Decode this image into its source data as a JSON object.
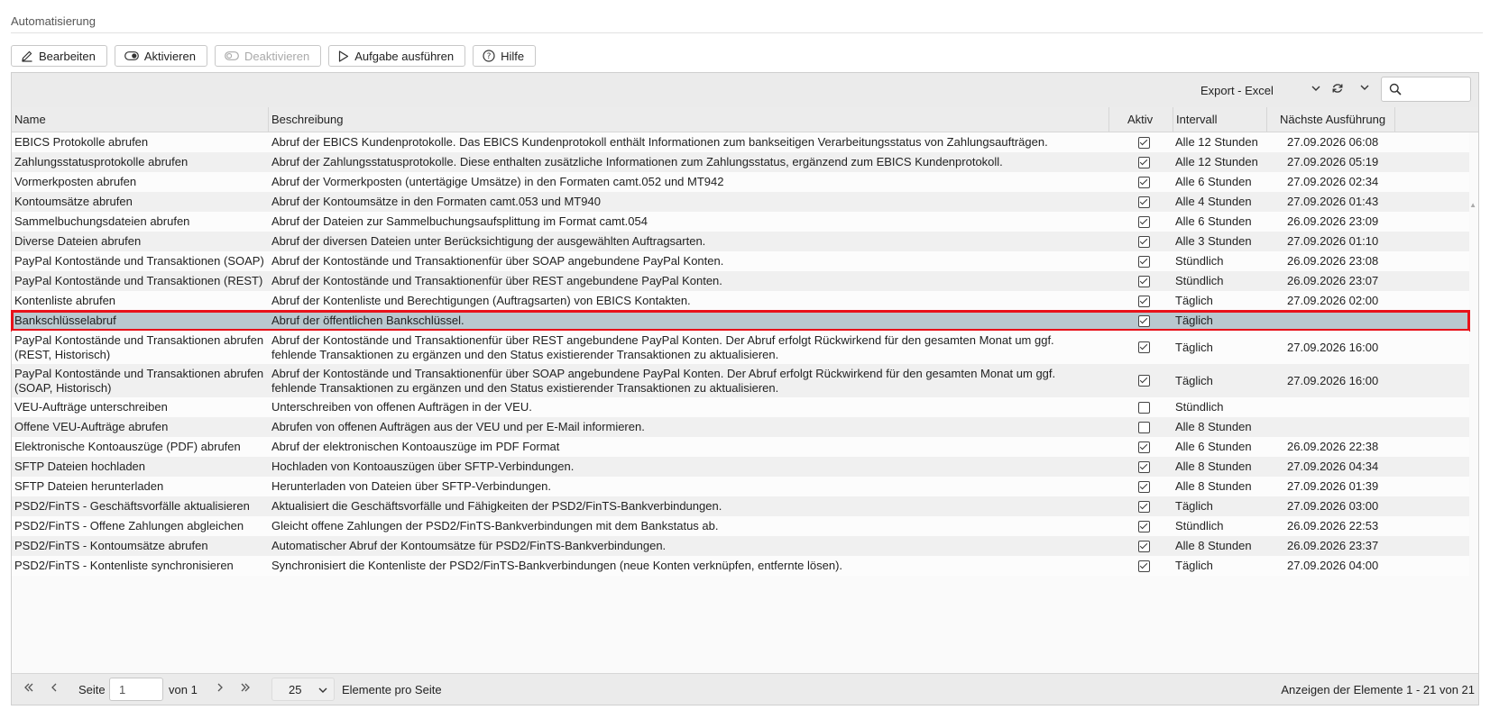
{
  "page": {
    "title": "Automatisierung"
  },
  "toolbar": {
    "edit": "Bearbeiten",
    "activate": "Aktivieren",
    "deactivate": "Deaktivieren",
    "run": "Aufgabe ausführen",
    "help": "Hilfe"
  },
  "grid_toolbar": {
    "export": "Export - Excel",
    "search_value": ""
  },
  "columns": {
    "name": "Name",
    "description": "Beschreibung",
    "active": "Aktiv",
    "interval": "Intervall",
    "next_run": "Nächste Ausführung"
  },
  "rows": [
    {
      "name": "EBICS Protokolle abrufen",
      "description": "Abruf der EBICS Kundenprotokolle. Das EBICS Kundenprotokoll enthält Informationen zum bankseitigen Verarbeitungsstatus von Zahlungsaufträgen.",
      "active": true,
      "interval": "Alle 12 Stunden",
      "next": "27.09.2026 06:08",
      "selected": false
    },
    {
      "name": "Zahlungsstatusprotokolle abrufen",
      "description": "Abruf der Zahlungsstatusprotokolle. Diese enthalten zusätzliche Informationen zum Zahlungsstatus, ergänzend zum EBICS Kundenprotokoll.",
      "active": true,
      "interval": "Alle 12 Stunden",
      "next": "27.09.2026 05:19",
      "selected": false
    },
    {
      "name": "Vormerkposten abrufen",
      "description": "Abruf der Vormerkposten (untertägige Umsätze) in den Formaten camt.052 und MT942",
      "active": true,
      "interval": "Alle 6 Stunden",
      "next": "27.09.2026 02:34",
      "selected": false
    },
    {
      "name": "Kontoumsätze abrufen",
      "description": "Abruf der Kontoumsätze in den Formaten camt.053 und MT940",
      "active": true,
      "interval": "Alle 4 Stunden",
      "next": "27.09.2026 01:43",
      "selected": false
    },
    {
      "name": "Sammelbuchungsdateien abrufen",
      "description": "Abruf der Dateien zur Sammelbuchungsaufsplittung im Format camt.054",
      "active": true,
      "interval": "Alle 6 Stunden",
      "next": "26.09.2026 23:09",
      "selected": false
    },
    {
      "name": "Diverse Dateien abrufen",
      "description": "Abruf der diversen Dateien unter Berücksichtigung der ausgewählten Auftragsarten.",
      "active": true,
      "interval": "Alle 3 Stunden",
      "next": "27.09.2026 01:10",
      "selected": false
    },
    {
      "name": "PayPal Kontostände und Transaktionen (SOAP)",
      "description": "Abruf der Kontostände und Transaktionenfür über SOAP angebundene PayPal Konten.",
      "active": true,
      "interval": "Stündlich",
      "next": "26.09.2026 23:08",
      "selected": false
    },
    {
      "name": "PayPal Kontostände und Transaktionen (REST)",
      "description": "Abruf der Kontostände und Transaktionenfür über REST angebundene PayPal Konten.",
      "active": true,
      "interval": "Stündlich",
      "next": "26.09.2026 23:07",
      "selected": false
    },
    {
      "name": "Kontenliste abrufen",
      "description": "Abruf der Kontenliste und Berechtigungen (Auftragsarten) von EBICS Kontakten.",
      "active": true,
      "interval": "Täglich",
      "next": "27.09.2026 02:00",
      "selected": false
    },
    {
      "name": "Bankschlüsselabruf",
      "description": "Abruf der öffentlichen Bankschlüssel.",
      "active": true,
      "interval": "Täglich",
      "next": "",
      "selected": true
    },
    {
      "name": "PayPal Kontostände und Transaktionen abrufen (REST, Historisch)",
      "description": "Abruf der Kontostände und Transaktionenfür über REST angebundene PayPal Konten. Der Abruf erfolgt Rückwirkend für den gesamten Monat um ggf. fehlende Transaktionen zu ergänzen und den Status existierender Transaktionen zu aktualisieren.",
      "active": true,
      "interval": "Täglich",
      "next": "27.09.2026 16:00",
      "selected": false,
      "tall": true
    },
    {
      "name": "PayPal Kontostände und Transaktionen abrufen (SOAP, Historisch)",
      "description": "Abruf der Kontostände und Transaktionenfür über SOAP angebundene PayPal Konten. Der Abruf erfolgt Rückwirkend für den gesamten Monat um ggf. fehlende Transaktionen zu ergänzen und den Status existierender Transaktionen zu aktualisieren.",
      "active": true,
      "interval": "Täglich",
      "next": "27.09.2026 16:00",
      "selected": false,
      "tall": true
    },
    {
      "name": "VEU-Aufträge unterschreiben",
      "description": "Unterschreiben von offenen Aufträgen in der VEU.",
      "active": false,
      "interval": "Stündlich",
      "next": "",
      "selected": false
    },
    {
      "name": "Offene VEU-Aufträge abrufen",
      "description": "Abrufen von offenen Aufträgen aus der VEU und per E-Mail informieren.",
      "active": false,
      "interval": "Alle 8 Stunden",
      "next": "",
      "selected": false
    },
    {
      "name": "Elektronische Kontoauszüge (PDF) abrufen",
      "description": "Abruf der elektronischen Kontoauszüge im PDF Format",
      "active": true,
      "interval": "Alle 6 Stunden",
      "next": "26.09.2026 22:38",
      "selected": false
    },
    {
      "name": "SFTP Dateien hochladen",
      "description": "Hochladen von Kontoauszügen über SFTP-Verbindungen.",
      "active": true,
      "interval": "Alle 8 Stunden",
      "next": "27.09.2026 04:34",
      "selected": false
    },
    {
      "name": "SFTP Dateien herunterladen",
      "description": "Herunterladen von Dateien über SFTP-Verbindungen.",
      "active": true,
      "interval": "Alle 8 Stunden",
      "next": "27.09.2026 01:39",
      "selected": false
    },
    {
      "name": "PSD2/FinTS - Geschäftsvorfälle aktualisieren",
      "description": "Aktualisiert die Geschäftsvorfälle und Fähigkeiten der PSD2/FinTS-Bankverbindungen.",
      "active": true,
      "interval": "Täglich",
      "next": "27.09.2026 03:00",
      "selected": false
    },
    {
      "name": "PSD2/FinTS - Offene Zahlungen abgleichen",
      "description": "Gleicht offene Zahlungen der PSD2/FinTS-Bankverbindungen mit dem Bankstatus ab.",
      "active": true,
      "interval": "Stündlich",
      "next": "26.09.2026 22:53",
      "selected": false
    },
    {
      "name": "PSD2/FinTS - Kontoumsätze abrufen",
      "description": "Automatischer Abruf der Kontoumsätze für PSD2/FinTS-Bankverbindungen.",
      "active": true,
      "interval": "Alle 8 Stunden",
      "next": "26.09.2026 23:37",
      "selected": false
    },
    {
      "name": "PSD2/FinTS - Kontenliste synchronisieren",
      "description": "Synchronisiert die Kontenliste der PSD2/FinTS-Bankverbindungen (neue Konten verknüpfen, entfernte lösen).",
      "active": true,
      "interval": "Täglich",
      "next": "27.09.2026 04:00",
      "selected": false
    }
  ],
  "pager": {
    "page_label": "Seite",
    "page_value": "1",
    "of_label": "von 1",
    "page_size": "25",
    "per_page_label": "Elemente pro Seite",
    "info": "Anzeigen der Elemente 1 - 21 von 21"
  },
  "colors": {
    "selected_row": "#b9c8cf",
    "highlight_border": "#e8121a"
  }
}
